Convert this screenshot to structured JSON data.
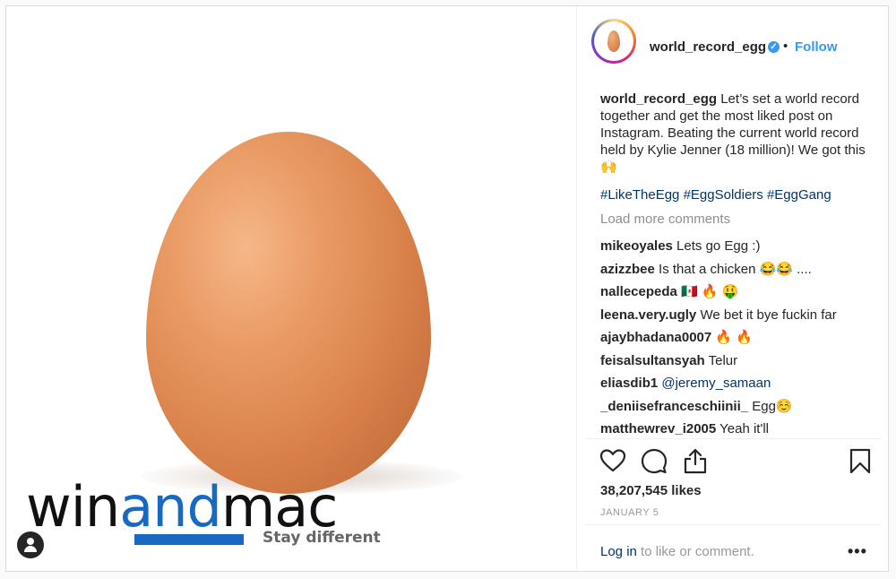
{
  "post": {
    "username": "world_record_egg",
    "verified_mark": "✓",
    "separator": "•",
    "follow_label": "Follow",
    "caption_user": "world_record_egg",
    "caption_text": " Let’s set a world record together and get the most liked post on Instagram. Beating the current world record held by Kylie Jenner (18 million)! We got this 🙌",
    "hashtags": "#LikeTheEgg #EggSoldiers #EggGang",
    "load_more": "Load more comments",
    "likes": "38,207,545 likes",
    "date": "JANUARY 5",
    "login_link": "Log in",
    "login_rest": " to like or comment.",
    "more_label": "•••"
  },
  "comments": [
    {
      "user": "mikeoyales",
      "text": " Lets go Egg :)"
    },
    {
      "user": "azizzbee",
      "text": " Is that a chicken 😂😂 ...."
    },
    {
      "user": "nallecepeda",
      "text": " 🇲🇽 🔥 🤑"
    },
    {
      "user": "leena.very.ugly",
      "text": " We bet it bye fuckin far"
    },
    {
      "user": "ajaybhadana0007",
      "text": " 🔥 🔥"
    },
    {
      "user": "feisalsultansyah",
      "text": " Telur"
    },
    {
      "user": "eliasdib1",
      "mention": " @jeremy_samaan"
    },
    {
      "user": "_deniisefranceschiinii_",
      "text": " Egg☺️"
    },
    {
      "user": "matthewrev_i2005",
      "text": " Yeah it'll"
    }
  ],
  "watermark": {
    "win": "win",
    "and": "and",
    "mac": "mac",
    "tagline": "Stay different"
  },
  "icons": [
    "heart-icon",
    "comment-icon",
    "share-icon",
    "bookmark-icon",
    "user-tag-icon",
    "verified-badge-icon"
  ],
  "colors": {
    "link": "#3897f0",
    "hashtag": "#003569",
    "brand_blue": "#1769c4",
    "muted": "#8e8e8e"
  }
}
